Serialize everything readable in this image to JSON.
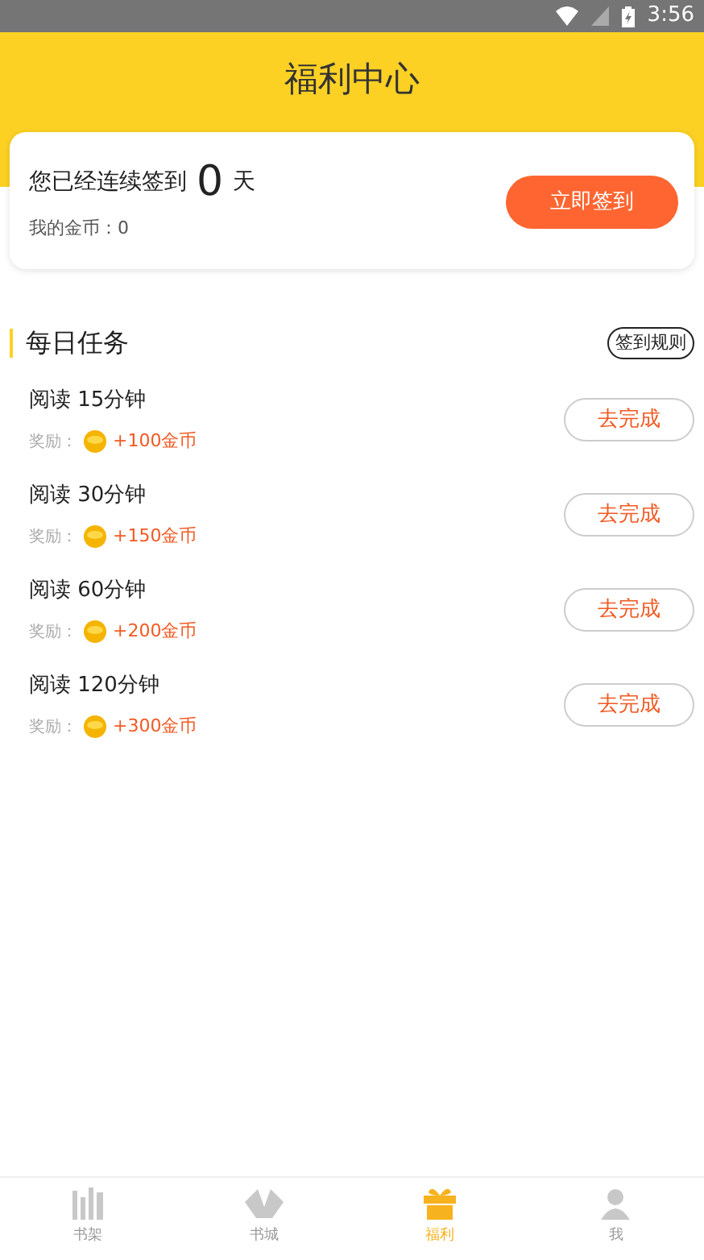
{
  "status_bar": {
    "time": "3:56"
  },
  "header": {
    "title": "福利中心"
  },
  "checkin": {
    "prefix": "您已经连续签到",
    "days": "0",
    "suffix": "天",
    "coins_label": "我的金币：0",
    "button": "立即签到"
  },
  "tasks_section": {
    "title": "每日任务",
    "rules_button": "签到规则",
    "tasks": [
      {
        "title": "阅读 15分钟",
        "reward_label": "奖励：",
        "reward": "+100金币",
        "button": "去完成"
      },
      {
        "title": "阅读 30分钟",
        "reward_label": "奖励：",
        "reward": "+150金币",
        "button": "去完成"
      },
      {
        "title": "阅读 60分钟",
        "reward_label": "奖励：",
        "reward": "+200金币",
        "button": "去完成"
      },
      {
        "title": "阅读 120分钟",
        "reward_label": "奖励：",
        "reward": "+300金币",
        "button": "去完成"
      }
    ]
  },
  "bottom_nav": [
    {
      "kind": "shelf",
      "label": "书架",
      "selected": false
    },
    {
      "kind": "store",
      "label": "书城",
      "selected": false
    },
    {
      "kind": "gift",
      "label": "福利",
      "selected": true
    },
    {
      "kind": "me",
      "label": "我",
      "selected": false
    }
  ]
}
